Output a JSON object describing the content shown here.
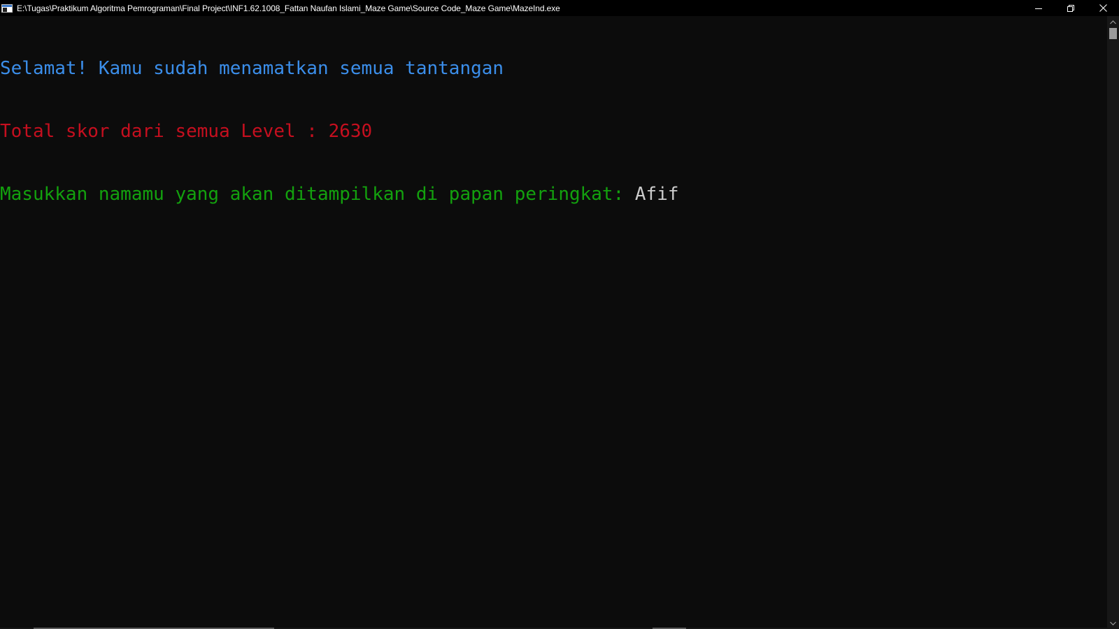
{
  "window": {
    "title": "E:\\Tugas\\Praktikum Algoritma Pemrograman\\Final Project\\INF1.62.1008_Fattan Naufan Islami_Maze Game\\Source Code_Maze Game\\MazeInd.exe",
    "icon": "console-app-icon",
    "controls": {
      "minimize": "minimize-icon",
      "restore": "restore-icon",
      "close": "close-icon"
    }
  },
  "console": {
    "lines": [
      {
        "text": "Selamat! Kamu sudah menamatkan semua tantangan",
        "color": "#3b8eea"
      },
      {
        "text": "Total skor dari semua Level : 2630",
        "color": "#c50f1f"
      },
      {
        "prompt": "Masukkan namamu yang akan ditampilkan di papan peringkat: ",
        "prompt_color": "#13a10e",
        "input": "Afif",
        "input_color": "#cccccc"
      }
    ]
  },
  "colors": {
    "background": "#0c0c0c",
    "titlebar": "#000000"
  }
}
